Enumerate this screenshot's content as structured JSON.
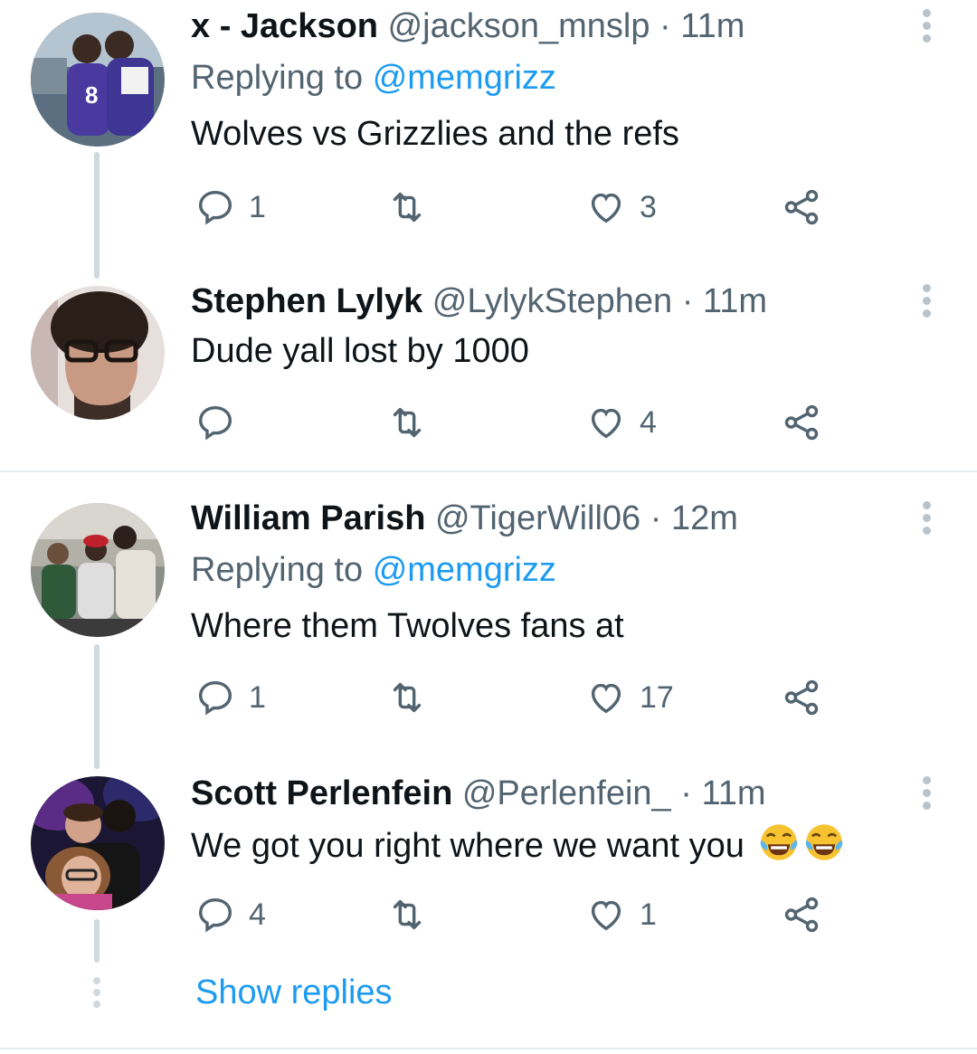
{
  "colors": {
    "link": "#1d9bf0",
    "muted": "#536471",
    "text": "#0f1419",
    "line": "#cfd9de"
  },
  "tweets": [
    {
      "name": "x - Jackson",
      "handle": "@jackson_mnslp",
      "dot": "·",
      "time": "11m",
      "replying_prefix": "Replying to",
      "replying_to": "@memgrizz",
      "text": "Wolves vs Grizzlies and the refs",
      "reply_count": "1",
      "retweet_count": "",
      "like_count": "3",
      "avatar_icon": "avatar-jackson"
    },
    {
      "name": "Stephen Lylyk",
      "handle": "@LylykStephen",
      "dot": "·",
      "time": "11m",
      "text": "Dude yall lost by 1000",
      "reply_count": "",
      "retweet_count": "",
      "like_count": "4",
      "avatar_icon": "avatar-stephen"
    },
    {
      "name": "William Parish",
      "handle": "@TigerWill06",
      "dot": "·",
      "time": "12m",
      "replying_prefix": "Replying to",
      "replying_to": "@memgrizz",
      "text": "Where them Twolves fans at",
      "reply_count": "1",
      "retweet_count": "",
      "like_count": "17",
      "avatar_icon": "avatar-william"
    },
    {
      "name": "Scott Perlenfein",
      "handle": "@Perlenfein_",
      "dot": "·",
      "time": "11m",
      "text": "We got you right where we want you",
      "emoji": "face-with-tears-of-joy",
      "reply_count": "4",
      "retweet_count": "",
      "like_count": "1",
      "avatar_icon": "avatar-scott"
    }
  ],
  "show_replies": "Show replies"
}
